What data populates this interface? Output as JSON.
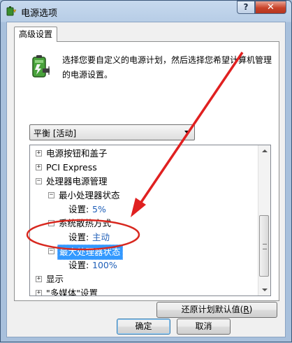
{
  "window": {
    "title": "电源选项",
    "help_glyph": "?",
    "close_glyph": "✕"
  },
  "tab": {
    "label": "高级设置"
  },
  "intro": {
    "text": "选择您要自定义的电源计划，然后选择您希望计算机管理的电源设置。"
  },
  "plan_select": {
    "selected": "平衡 [活动]"
  },
  "tree": {
    "items": [
      {
        "expander": "+",
        "label": "电源按钮和盖子"
      },
      {
        "expander": "+",
        "label": "PCI Express"
      },
      {
        "expander": "−",
        "label": "处理器电源管理"
      },
      {
        "expander": "−",
        "label": "最小处理器状态"
      },
      {
        "setting_label": "设置:",
        "value": "5%"
      },
      {
        "expander": "−",
        "label": "系统散热方式"
      },
      {
        "setting_label": "设置:",
        "value": "主动"
      },
      {
        "expander": "−",
        "label": "最大处理器状态"
      },
      {
        "setting_label": "设置:",
        "value": "100%"
      },
      {
        "expander": "+",
        "label": "显示"
      },
      {
        "expander": "+",
        "label": "\"多媒体\"设置"
      }
    ]
  },
  "buttons": {
    "restore_label": "还原计划默认值(",
    "restore_key": "R",
    "restore_suffix": ")",
    "ok_label": "确定",
    "cancel_label": "取消"
  },
  "annotation_colors": {
    "arrow": "#e02020",
    "ellipse": "#d8281f"
  }
}
